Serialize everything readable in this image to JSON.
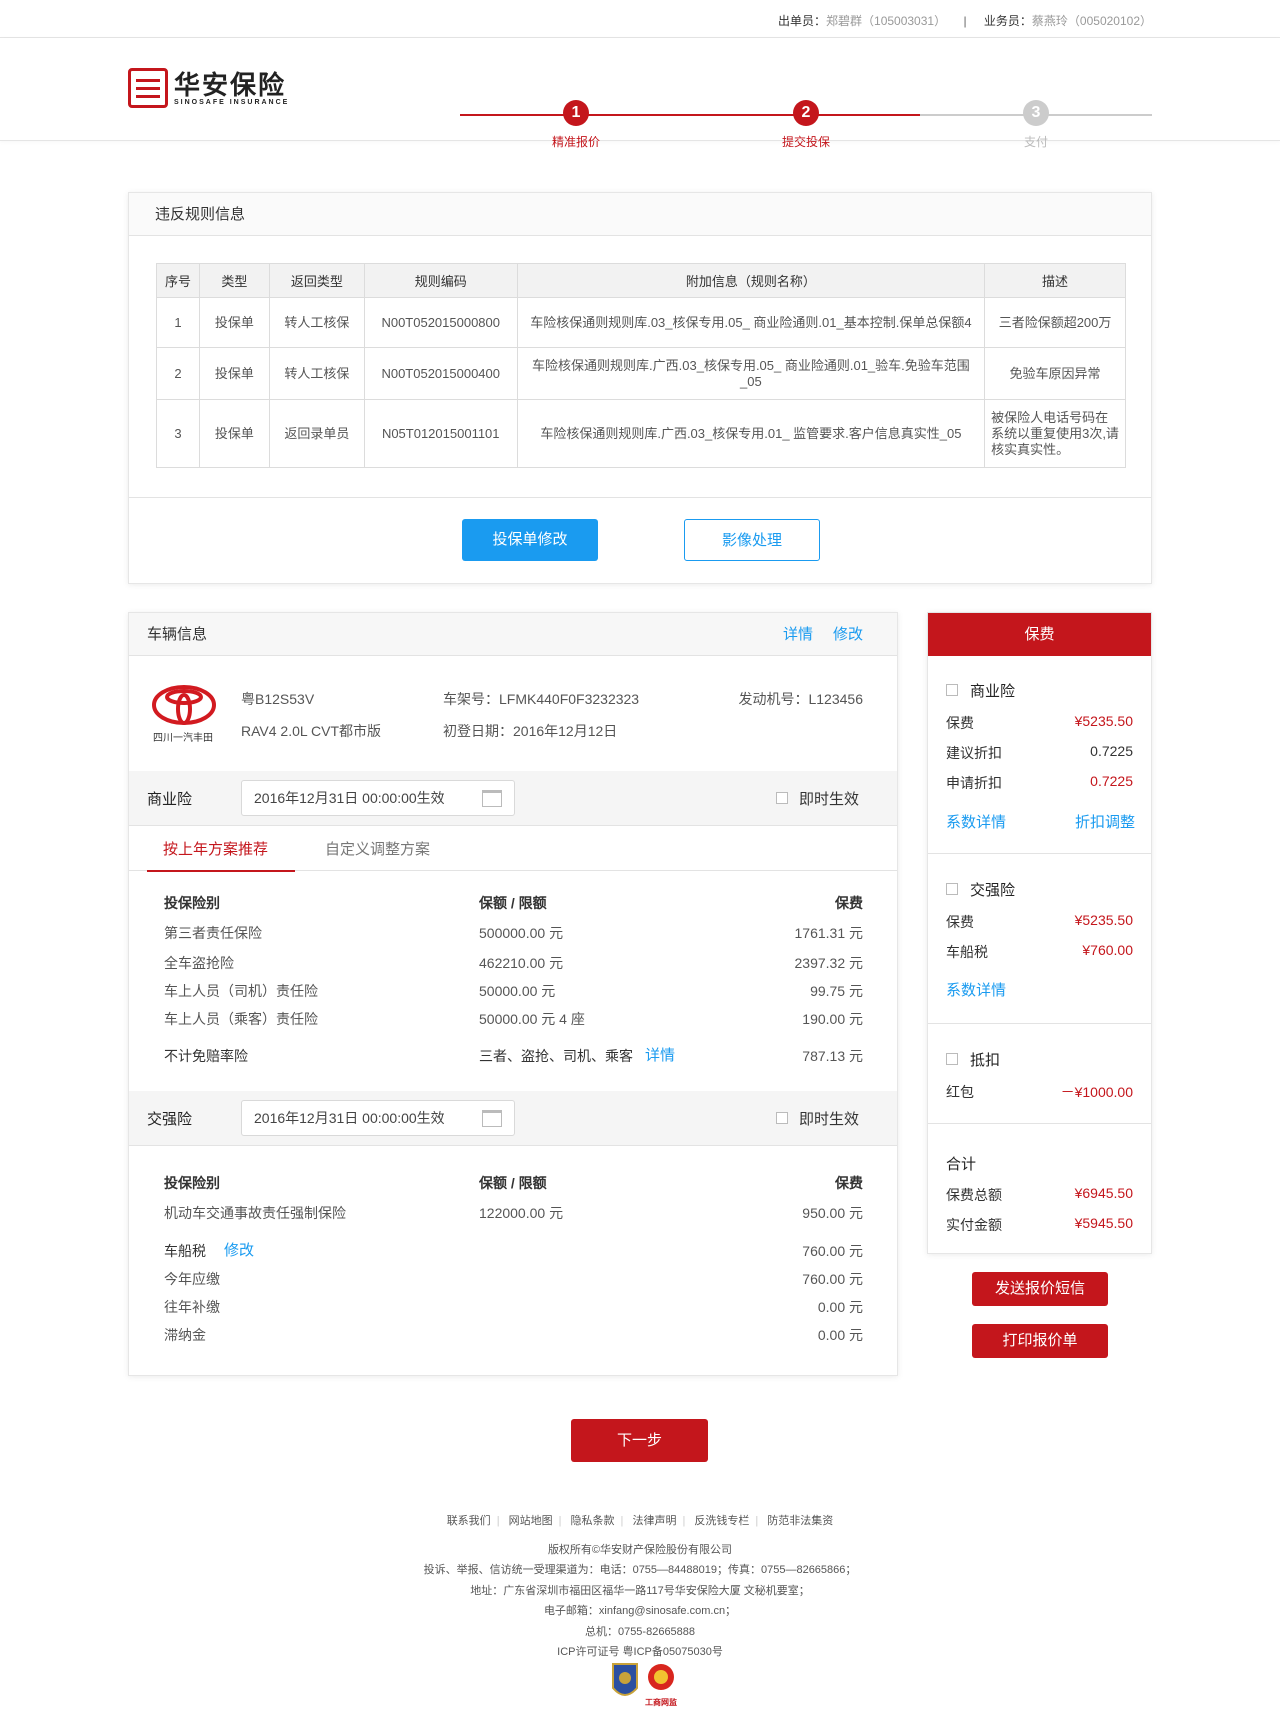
{
  "topbar": {
    "issuer_label": "出单员：",
    "issuer": "郑碧群（105003031）",
    "sep": "|",
    "sales_label": "业务员：",
    "sales": "蔡燕玲（005020102）"
  },
  "brand": {
    "name_cn": "华安保险",
    "name_en": "SINOSAFE INSURANCE"
  },
  "steps": [
    {
      "num": "1",
      "label": "精准报价",
      "active": true
    },
    {
      "num": "2",
      "label": "提交投保",
      "active": true
    },
    {
      "num": "3",
      "label": "支付",
      "active": false
    }
  ],
  "colors": {
    "accent": "#c4161c",
    "link": "#1a9bf0",
    "inactive": "#cccccc"
  },
  "rules": {
    "title": "违反规则信息",
    "headers": [
      "序号",
      "类型",
      "返回类型",
      "规则编码",
      "附加信息（规则名称）",
      "描述"
    ],
    "rows": [
      [
        "1",
        "投保单",
        "转人工核保",
        "N00T052015000800",
        "车险核保通则规则库.03_核保专用.05_ 商业险通则.01_基本控制.保单总保额4",
        "三者险保额超200万"
      ],
      [
        "2",
        "投保单",
        "转人工核保",
        "N00T052015000400",
        "车险核保通则规则库.广西.03_核保专用.05_ 商业险通则.01_验车.免验车范围_05",
        "免验车原因异常"
      ],
      [
        "3",
        "投保单",
        "返回录单员",
        "N05T012015001101",
        "车险核保通则规则库.广西.03_核保专用.01_ 监管要求.客户信息真实性_05",
        "被保险人电话号码在系统以重复使用3次,请核实真实性。"
      ]
    ],
    "btn_modify": "投保单修改",
    "btn_image": "影像处理"
  },
  "vehicle": {
    "title": "车辆信息",
    "detail_link": "详情",
    "edit_link": "修改",
    "brand_caption": "四川一汽丰田",
    "plate": "粤B12S53V",
    "model": "RAV4 2.0L CVT都市版",
    "vin": "车架号：LFMK440F0F3232323",
    "reg_date": "初登日期：2016年12月12日",
    "engine": "发动机号：L123456"
  },
  "commercial": {
    "label": "商业险",
    "date": "2016年12月31日  00:00:00生效",
    "instant": "即时生效",
    "tab_active": "按上年方案推荐",
    "tab_other": "自定义调整方案",
    "headers": [
      "投保险别",
      "保额 / 限额",
      "保费"
    ],
    "rows": [
      [
        "第三者责任保险",
        "500000.00 元",
        "1761.31 元"
      ],
      [
        "全车盗抢险",
        "462210.00 元",
        "2397.32 元"
      ],
      [
        "车上人员（司机）责任险",
        "50000.00 元",
        "99.75 元"
      ],
      [
        "车上人员（乘客）责任险",
        "50000.00 元 4 座",
        "190.00 元"
      ]
    ],
    "deductible": {
      "name": "不计免赔率险",
      "coverage": "三者、盗抢、司机、乘客",
      "link": "详情",
      "premium": "787.13 元"
    }
  },
  "compulsory": {
    "label": "交强险",
    "date": "2016年12月31日  00:00:00生效",
    "instant": "即时生效",
    "headers": [
      "投保险别",
      "保额 / 限额",
      "保费"
    ],
    "row": [
      "机动车交通事故责任强制保险",
      "122000.00 元",
      "950.00 元"
    ],
    "tax_label": "车船税",
    "tax_edit": "修改",
    "tax_total": "760.00 元",
    "tax_rows": [
      [
        "今年应缴",
        "760.00 元"
      ],
      [
        "往年补缴",
        "0.00 元"
      ],
      [
        "滞纳金",
        "0.00 元"
      ]
    ]
  },
  "premium": {
    "title": "保费",
    "commercial": {
      "label": "商业险",
      "rows": [
        [
          "保费",
          "¥5235.50"
        ],
        [
          "建议折扣",
          "0.7225"
        ],
        [
          "申请折扣",
          "0.7225"
        ]
      ],
      "link1": "系数详情",
      "link2": "折扣调整"
    },
    "compulsory": {
      "label": "交强险",
      "rows": [
        [
          "保费",
          "¥5235.50"
        ],
        [
          "车船税",
          "¥760.00"
        ]
      ],
      "link": "系数详情"
    },
    "deduct": {
      "label": "抵扣",
      "row": [
        "红包",
        "－¥1000.00"
      ]
    },
    "total": {
      "label": "合计",
      "rows": [
        [
          "保费总额",
          "¥6945.50"
        ],
        [
          "实付金额",
          "¥5945.50"
        ]
      ]
    },
    "btn_sms": "发送报价短信",
    "btn_print": "打印报价单"
  },
  "next_button": "下一步",
  "footer": {
    "links": [
      "联系我们",
      "网站地图",
      "隐私条款",
      "法律声明",
      "反洗钱专栏",
      "防范非法集资"
    ],
    "lines": [
      "版权所有©华安财产保险股份有限公司",
      "投诉、举报、信访统一受理渠道为：电话：0755—84488019；传真：0755—82665866；",
      "地址：广东省深圳市福田区福华一路117号华安保险大厦 文秘机要室；",
      "电子邮箱：xinfang@sinosafe.com.cn；",
      "总机：0755-82665888",
      "ICP许可证号 粤ICP备05075030号"
    ],
    "badge_caption": "工商网监"
  }
}
